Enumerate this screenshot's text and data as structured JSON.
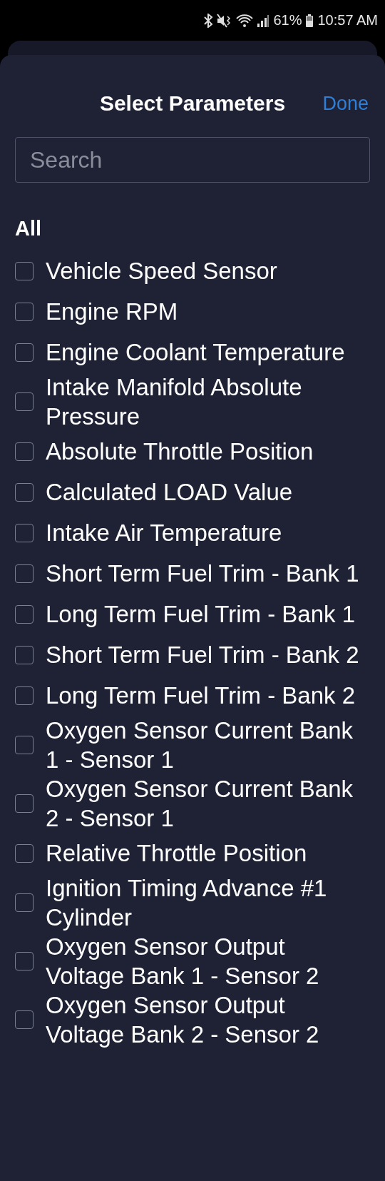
{
  "status_bar": {
    "battery": "61%",
    "time": "10:57 AM"
  },
  "sheet": {
    "title": "Select Parameters",
    "done": "Done"
  },
  "search": {
    "placeholder": "Search"
  },
  "section": "All",
  "items": [
    {
      "label": "Vehicle Speed Sensor",
      "checked": false
    },
    {
      "label": "Engine RPM",
      "checked": false
    },
    {
      "label": "Engine Coolant Temperature",
      "checked": false
    },
    {
      "label": "Intake Manifold Absolute Pressure",
      "checked": false
    },
    {
      "label": "Absolute Throttle Position",
      "checked": false
    },
    {
      "label": "Calculated LOAD Value",
      "checked": false
    },
    {
      "label": "Intake Air Temperature",
      "checked": false
    },
    {
      "label": "Short Term Fuel Trim - Bank 1",
      "checked": false
    },
    {
      "label": "Long Term Fuel Trim - Bank 1",
      "checked": false
    },
    {
      "label": "Short Term Fuel Trim - Bank 2",
      "checked": false
    },
    {
      "label": "Long Term Fuel Trim - Bank 2",
      "checked": false
    },
    {
      "label": "Oxygen Sensor Current Bank 1 - Sensor 1",
      "checked": false
    },
    {
      "label": "Oxygen Sensor Current Bank 2 - Sensor 1",
      "checked": false
    },
    {
      "label": "Relative Throttle Position",
      "checked": false
    },
    {
      "label": "Ignition Timing Advance #1 Cylinder",
      "checked": false
    },
    {
      "label": "Oxygen Sensor Output Voltage Bank 1 - Sensor 2",
      "checked": false
    },
    {
      "label": "Oxygen Sensor Output Voltage Bank 2 - Sensor 2",
      "checked": false
    }
  ]
}
